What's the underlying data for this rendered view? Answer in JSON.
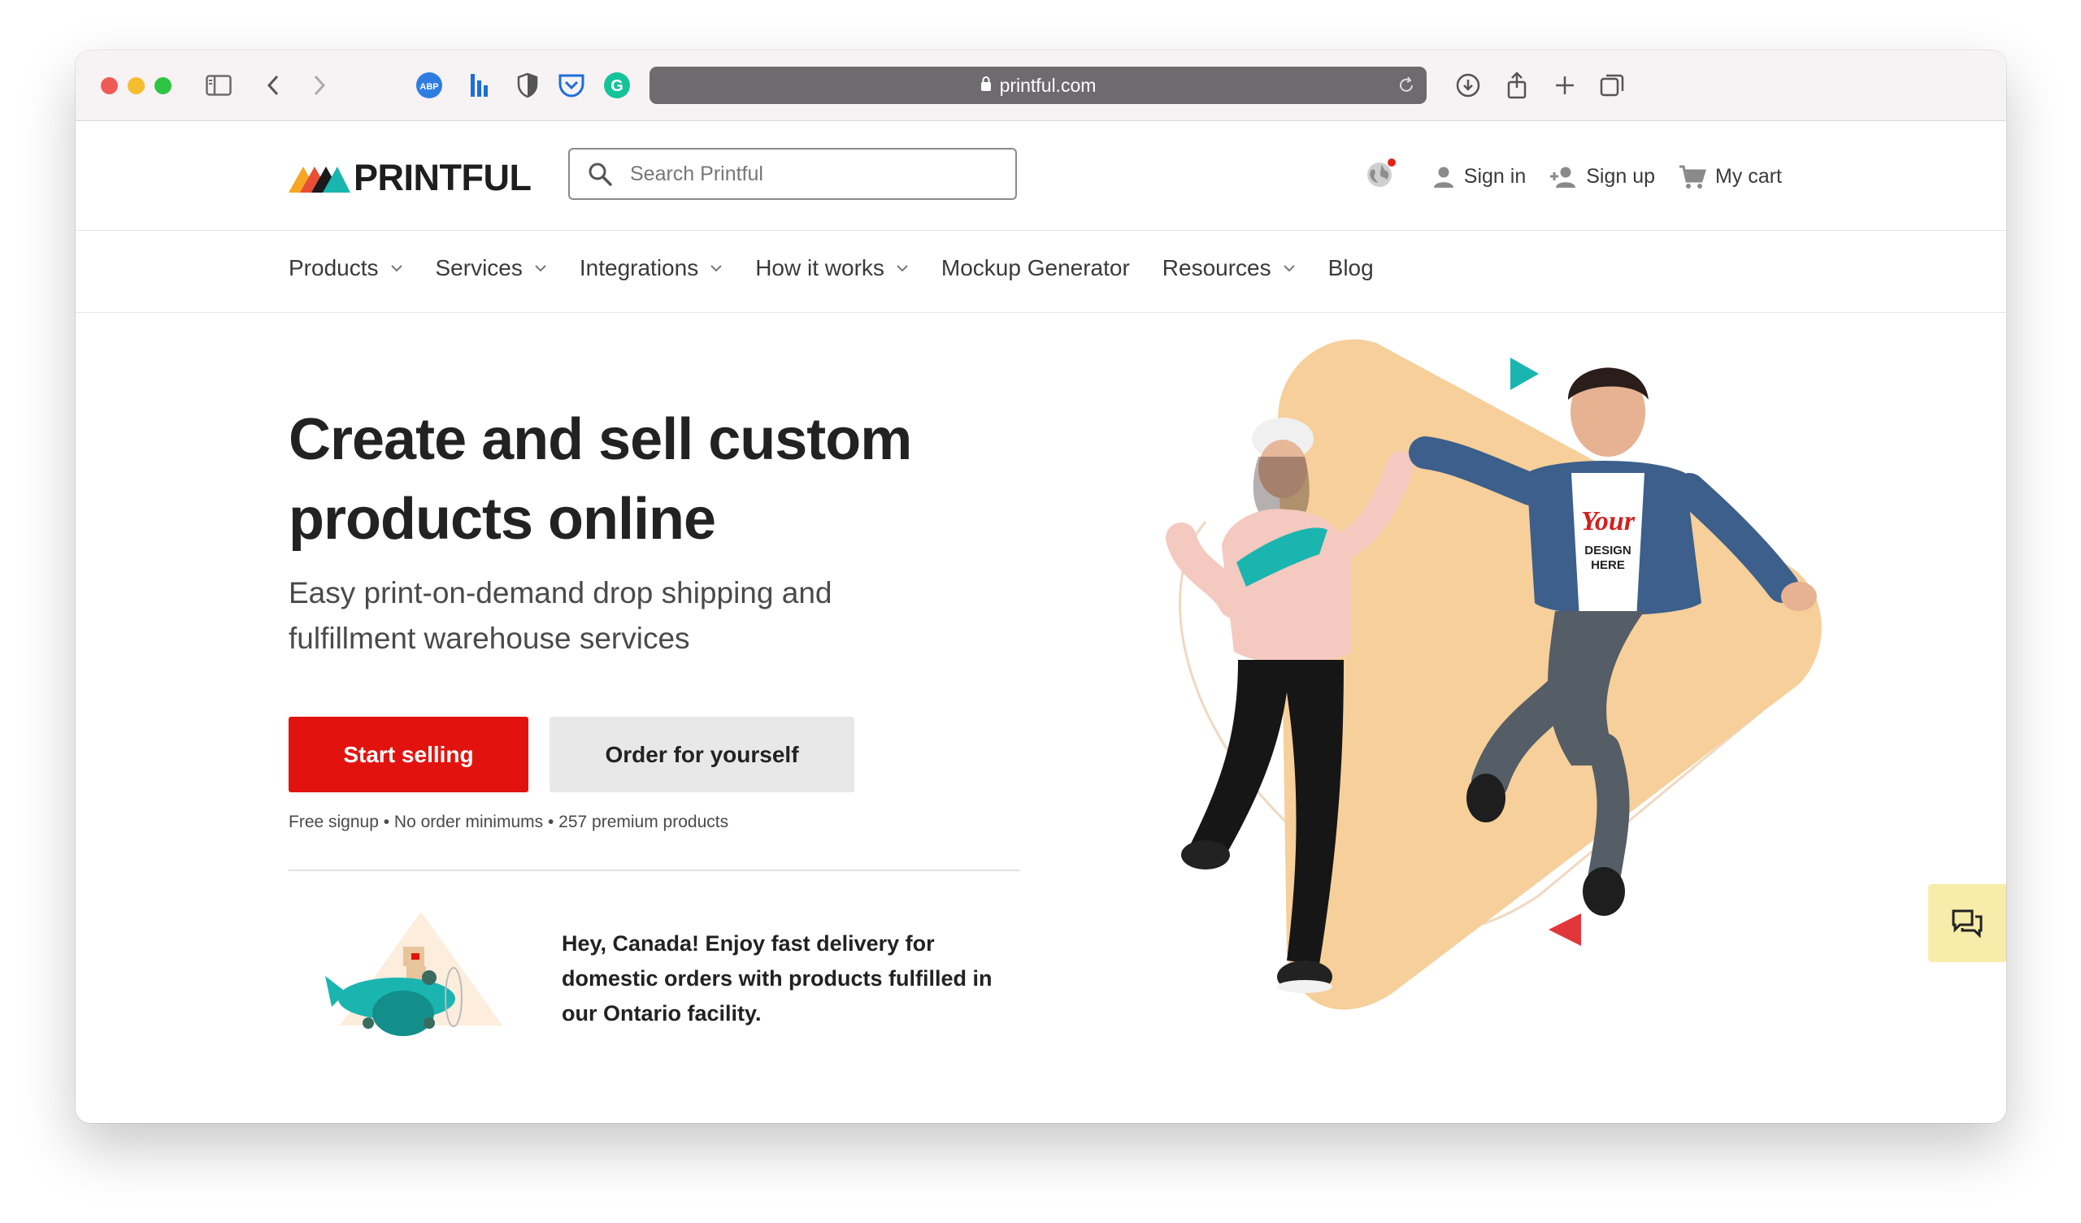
{
  "browser": {
    "url": "printful.com",
    "extensions": [
      "adblock-plus-icon",
      "bitwarden-icon",
      "privacy-shield-icon",
      "pocket-icon",
      "grammarly-icon"
    ]
  },
  "header": {
    "logo_text": "PRINTFUL",
    "search_placeholder": "Search Printful",
    "sign_in": "Sign in",
    "sign_up": "Sign up",
    "cart": "My cart"
  },
  "nav": {
    "items": [
      {
        "label": "Products",
        "dropdown": true
      },
      {
        "label": "Services",
        "dropdown": true
      },
      {
        "label": "Integrations",
        "dropdown": true
      },
      {
        "label": "How it works",
        "dropdown": true
      },
      {
        "label": "Mockup Generator",
        "dropdown": false
      },
      {
        "label": "Resources",
        "dropdown": true
      },
      {
        "label": "Blog",
        "dropdown": false
      }
    ]
  },
  "hero": {
    "title": "Create and sell custom products online",
    "subtitle": "Easy print-on-demand drop shipping and fulfillment warehouse services",
    "primary_cta": "Start selling",
    "secondary_cta": "Order for yourself",
    "perks": "Free signup • No order minimums • 257 premium products",
    "tshirt_print": [
      "Your",
      "DESIGN",
      "HERE"
    ]
  },
  "promo": {
    "text": "Hey, Canada! Enjoy fast delivery for domestic orders with products fulfilled in our Ontario facility."
  },
  "colors": {
    "brand_red": "#e2130f",
    "secondary_gray": "#e8e8e8",
    "chat_yellow": "#f8ecaa",
    "accent_teal": "#1bb5b0",
    "peach": "#f6cf9a"
  }
}
